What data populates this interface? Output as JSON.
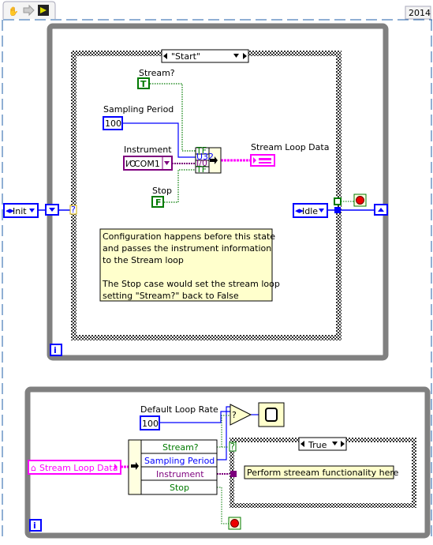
{
  "toolbar": {
    "icons": [
      "hand-icon",
      "arrow-right-icon",
      "vi-icon"
    ],
    "version": "2014"
  },
  "top_loop": {
    "iteration_label": "i",
    "shift_register_init": "Init",
    "next_state": "Idle",
    "case_selector": "\"Start\"",
    "controls": {
      "stream_label": "Stream?",
      "stream_value": "T",
      "sampling_label": "Sampling Period",
      "sampling_value": "100",
      "instrument_label": "Instrument",
      "instrument_value": "COM1",
      "stop_label": "Stop",
      "stop_value": "F"
    },
    "bundle_terms": [
      "TF",
      "U32",
      "I/0",
      "TF"
    ],
    "output_label": "Stream Loop Data",
    "comment": [
      "Configuration happens before this state",
      "and passes the instrument information",
      "to the Stream loop",
      "",
      "The Stop case would set the stream loop",
      "setting \"Stream?\" back to False"
    ],
    "question": "?"
  },
  "bottom_loop": {
    "iteration_label": "i",
    "input_label": "Stream Loop Data",
    "default_rate_label": "Default Loop Rate",
    "default_rate_value": "100",
    "unbundle_items": [
      "Stream?",
      "Sampling Period",
      "Instrument",
      "Stop"
    ],
    "case_selector": "True",
    "case_comment": "Perform streeam functionality here",
    "question": "?"
  },
  "colors": {
    "boolean": "#007a00",
    "numeric": "#0000ff",
    "io": "#7d007d",
    "cluster": "#ff00ff",
    "loop": "#808080",
    "comment_bg": "#ffffcc"
  }
}
